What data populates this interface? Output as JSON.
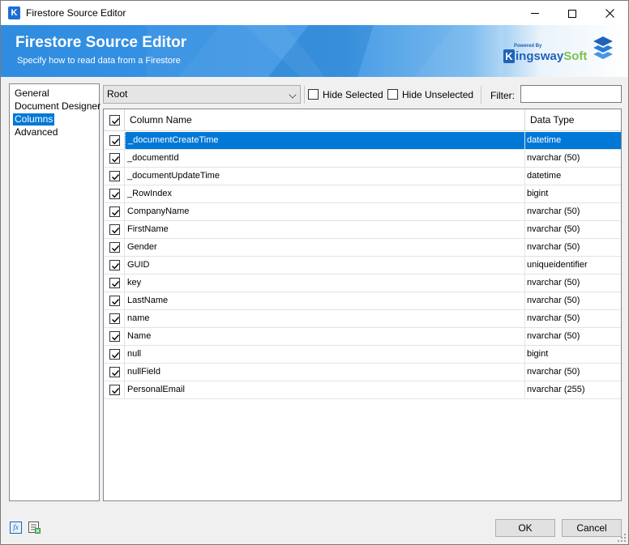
{
  "window": {
    "title": "Firestore Source Editor",
    "app_icon_letter": "K",
    "controls": [
      "minimize-icon",
      "maximize-icon",
      "close-icon"
    ]
  },
  "banner": {
    "title": "Firestore Source Editor",
    "subtitle": "Specify how to read data from a Firestore",
    "powered_by": "Powered By",
    "brand_k": "K",
    "brand_main": "ingsway",
    "brand_soft": "Soft"
  },
  "nav": {
    "items": [
      {
        "label": "General",
        "selected": false
      },
      {
        "label": "Document Designer",
        "selected": false
      },
      {
        "label": "Columns",
        "selected": true
      },
      {
        "label": "Advanced",
        "selected": false
      }
    ]
  },
  "toolbar": {
    "document_select": "Root",
    "hide_selected": {
      "label": "Hide Selected",
      "checked": false
    },
    "hide_unselected": {
      "label": "Hide Unselected",
      "checked": false
    },
    "filter_label": "Filter:",
    "filter_value": ""
  },
  "grid": {
    "header_checked": true,
    "columns": {
      "name": "Column Name",
      "type": "Data Type"
    },
    "rows": [
      {
        "checked": true,
        "name": "_documentCreateTime",
        "type": "datetime",
        "selected": true
      },
      {
        "checked": true,
        "name": "_documentId",
        "type": "nvarchar (50)",
        "selected": false
      },
      {
        "checked": true,
        "name": "_documentUpdateTime",
        "type": "datetime",
        "selected": false
      },
      {
        "checked": true,
        "name": "_RowIndex",
        "type": "bigint",
        "selected": false
      },
      {
        "checked": true,
        "name": "CompanyName",
        "type": "nvarchar (50)",
        "selected": false
      },
      {
        "checked": true,
        "name": "FirstName",
        "type": "nvarchar (50)",
        "selected": false
      },
      {
        "checked": true,
        "name": "Gender",
        "type": "nvarchar (50)",
        "selected": false
      },
      {
        "checked": true,
        "name": "GUID",
        "type": "uniqueidentifier",
        "selected": false
      },
      {
        "checked": true,
        "name": "key",
        "type": "nvarchar (50)",
        "selected": false
      },
      {
        "checked": true,
        "name": "LastName",
        "type": "nvarchar (50)",
        "selected": false
      },
      {
        "checked": true,
        "name": "name",
        "type": "nvarchar (50)",
        "selected": false
      },
      {
        "checked": true,
        "name": "Name",
        "type": "nvarchar (50)",
        "selected": false
      },
      {
        "checked": true,
        "name": "null",
        "type": "bigint",
        "selected": false
      },
      {
        "checked": true,
        "name": "nullField",
        "type": "nvarchar (50)",
        "selected": false
      },
      {
        "checked": true,
        "name": "PersonalEmail",
        "type": "nvarchar (255)",
        "selected": false
      }
    ]
  },
  "footer": {
    "expression_icon": "fx",
    "ok_label": "OK",
    "cancel_label": "Cancel"
  },
  "colors": {
    "selection": "#0078d7",
    "banner": "#2f8ce0",
    "brand": "#1e63b8",
    "brand_accent": "#7ec04a"
  }
}
